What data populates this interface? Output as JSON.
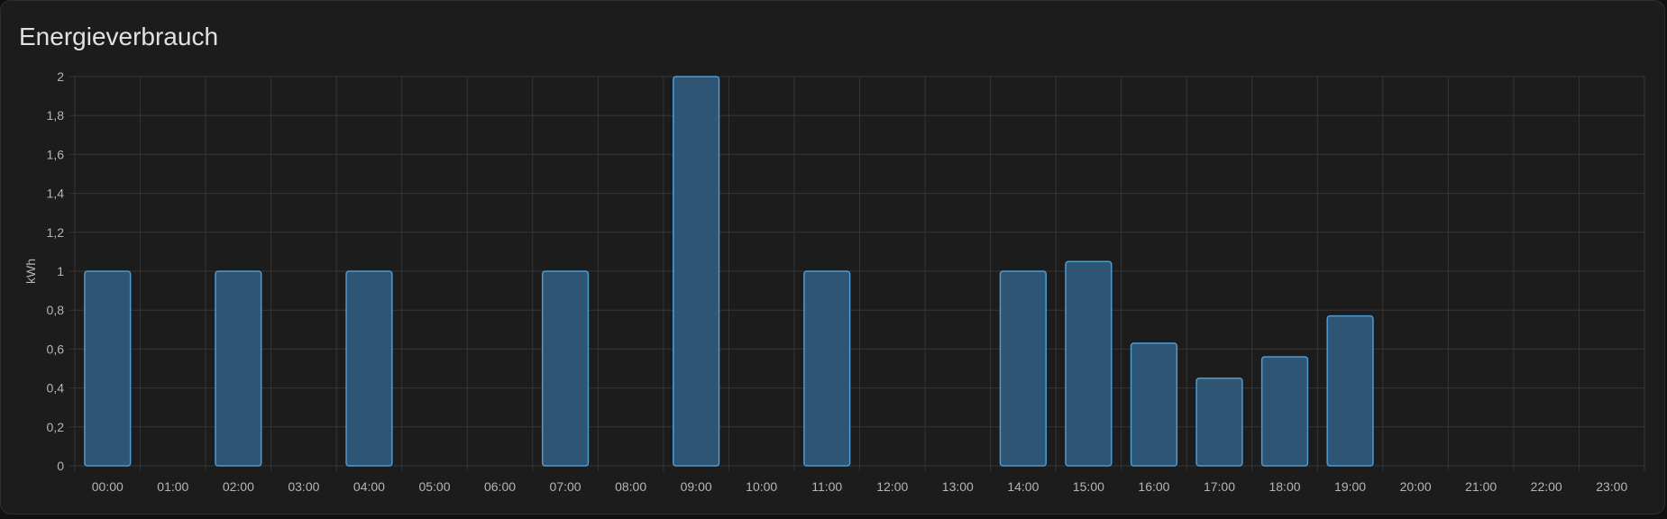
{
  "card": {
    "title": "Energieverbrauch"
  },
  "colors": {
    "bar_fill": "#2e5574",
    "bar_stroke": "#4f9ad1",
    "grid": "#363636",
    "background": "#1c1c1c"
  },
  "chart_data": {
    "type": "bar",
    "title": "",
    "xlabel": "",
    "ylabel": "kWh",
    "ylim": [
      0,
      2
    ],
    "yticks": [
      "0",
      "0,2",
      "0,4",
      "0,6",
      "0,8",
      "1",
      "1,2",
      "1,4",
      "1,6",
      "1,8",
      "2"
    ],
    "grid": true,
    "categories": [
      "00:00",
      "01:00",
      "02:00",
      "03:00",
      "04:00",
      "05:00",
      "06:00",
      "07:00",
      "08:00",
      "09:00",
      "10:00",
      "11:00",
      "12:00",
      "13:00",
      "14:00",
      "15:00",
      "16:00",
      "17:00",
      "18:00",
      "19:00",
      "20:00",
      "21:00",
      "22:00",
      "23:00"
    ],
    "values": [
      1.0,
      0,
      1.0,
      0,
      1.0,
      0,
      0,
      1.0,
      0,
      2.0,
      0,
      1.0,
      0,
      0,
      1.0,
      1.05,
      0.63,
      0.45,
      0.56,
      0.77,
      0,
      0,
      0,
      0
    ]
  }
}
